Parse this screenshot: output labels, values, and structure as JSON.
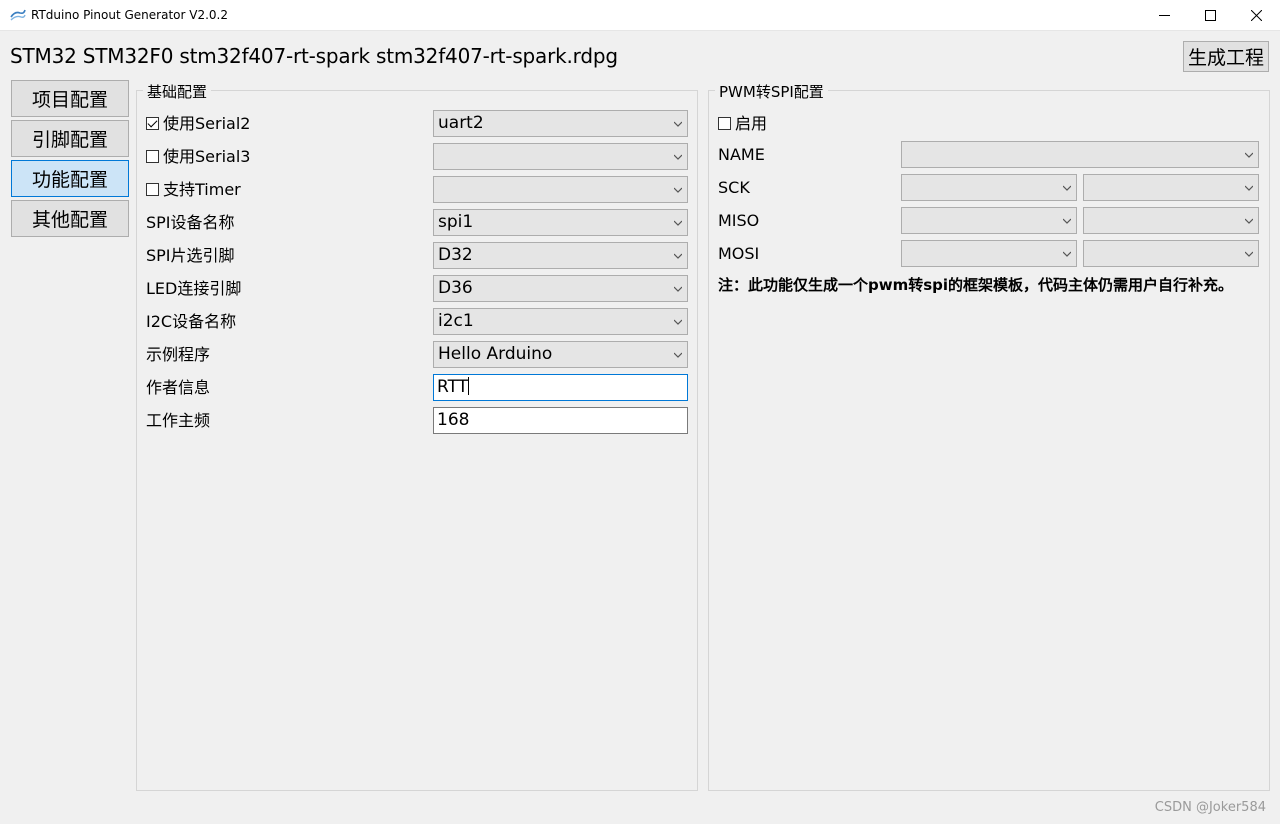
{
  "window": {
    "title": "RTduino Pinout Generator V2.0.2",
    "controls": [
      "minimize",
      "maximize",
      "close"
    ]
  },
  "header": {
    "path": "STM32 STM32F0 stm32f407-rt-spark stm32f407-rt-spark.rdpg",
    "generate_label": "生成工程"
  },
  "nav": {
    "items": [
      {
        "label": "项目配置",
        "active": false
      },
      {
        "label": "引脚配置",
        "active": false
      },
      {
        "label": "功能配置",
        "active": true
      },
      {
        "label": "其他配置",
        "active": false
      }
    ]
  },
  "basic": {
    "title": "基础配置",
    "serial2": {
      "label": "使用Serial2",
      "checked": true,
      "value": "uart2"
    },
    "serial3": {
      "label": "使用Serial3",
      "checked": false,
      "value": ""
    },
    "timer": {
      "label": "支持Timer",
      "checked": false,
      "value": ""
    },
    "spi_name": {
      "label": "SPI设备名称",
      "value": "spi1"
    },
    "spi_cs": {
      "label": "SPI片选引脚",
      "value": "D32"
    },
    "led": {
      "label": "LED连接引脚",
      "value": "D36"
    },
    "i2c": {
      "label": "I2C设备名称",
      "value": "i2c1"
    },
    "example": {
      "label": "示例程序",
      "value": "Hello Arduino"
    },
    "author": {
      "label": "作者信息",
      "value": "RTT"
    },
    "freq": {
      "label": "工作主频",
      "value": "168"
    }
  },
  "pwm": {
    "title": "PWM转SPI配置",
    "enable_label": "启用",
    "enabled": false,
    "name_label": "NAME",
    "sck_label": "SCK",
    "miso_label": "MISO",
    "mosi_label": "MOSI",
    "note": "注：此功能仅生成一个pwm转spi的框架模板，代码主体仍需用户自行补充。"
  },
  "watermark": "CSDN @Joker584",
  "colors": {
    "accent": "#0078d7",
    "active_nav": "#cce4f7",
    "button": "#e1e1e1"
  },
  "icons": {
    "dropdown": "chevron-down-icon",
    "app": "app-icon"
  }
}
